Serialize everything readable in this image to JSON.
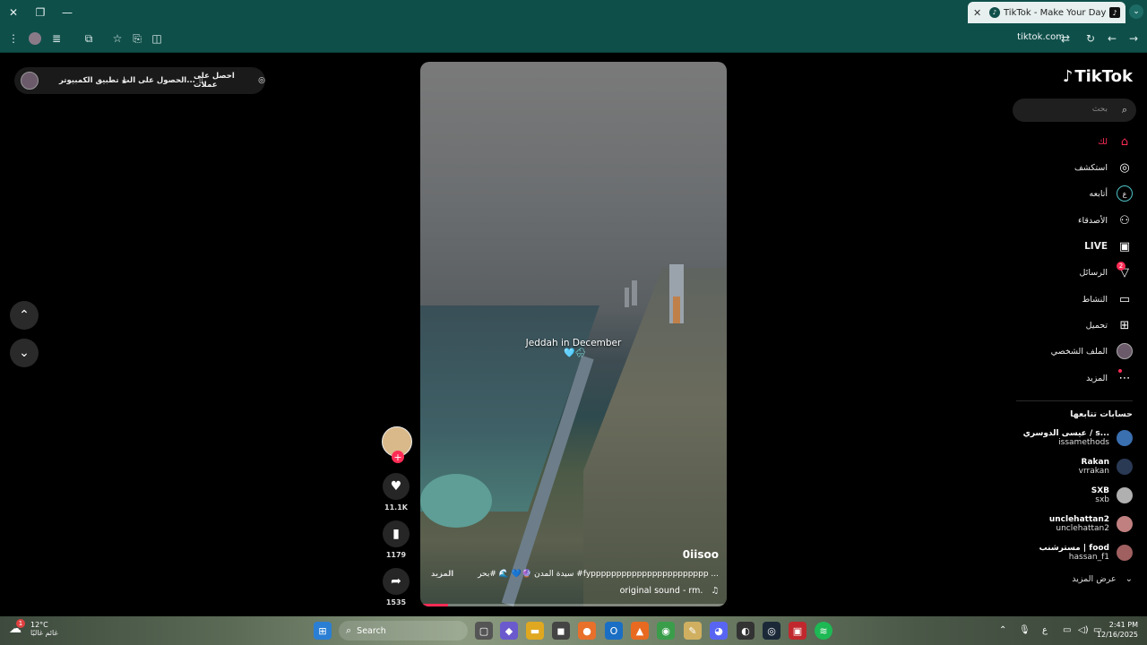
{
  "browser": {
    "tab_title": "TikTok - Make Your Day",
    "url": "tikotok.com",
    "new_tab_label": "+",
    "icons": [
      "close-icon",
      "restore-icon",
      "minimize-icon",
      "menu-icon",
      "profile-icon",
      "media-icon",
      "extensions-icon",
      "star-icon",
      "collections-icon",
      "split-icon",
      "reload-icon",
      "back-icon",
      "forward-icon",
      "tab-dropdown-icon"
    ]
  },
  "url_display": "tiktok.com",
  "promo": {
    "get_coins": "احصل على عملات",
    "get_app": "الحصول على الت...",
    "desktop_app": "تطبيق الكمبيوتر"
  },
  "video": {
    "caption": "Jeddah in December",
    "emoji": "🩵🌧",
    "author": "0iisoo",
    "description": "سيدة المدن 🔮💙 🌊 #بحر #fyppppppppppppppppppppppp ...",
    "more": "المزيد",
    "sound": "original sound - rm.",
    "progress": 0.09
  },
  "actions": {
    "likes": "11.1K",
    "saves": "1179",
    "shares": "1535"
  },
  "sidebar": {
    "logo": "TikTok",
    "search_placeholder": "بحث",
    "items": [
      {
        "label": "لك",
        "icon": "home-icon"
      },
      {
        "label": "استكشف",
        "icon": "compass-icon"
      },
      {
        "label": "أتابعه",
        "icon": "following-icon"
      },
      {
        "label": "الأصدقاء",
        "icon": "friends-icon"
      },
      {
        "label": "LIVE",
        "icon": "live-icon"
      },
      {
        "label": "الرسائل",
        "icon": "messages-icon",
        "badge": "2"
      },
      {
        "label": "النشاط",
        "icon": "activity-icon"
      },
      {
        "label": "تحميل",
        "icon": "upload-icon"
      },
      {
        "label": "الملف الشخصي",
        "icon": "profile-icon"
      },
      {
        "label": "المزيد",
        "icon": "more-icon"
      }
    ],
    "following_title": "حسابات تتابعها",
    "accounts": [
      {
        "display": "عيسى الدوسري / s...",
        "user": "issamethods",
        "color": "#3a6fb0"
      },
      {
        "display": "Rakan",
        "user": "vrrakan",
        "color": "#2a3a55"
      },
      {
        "display": "SXB",
        "user": "sxb",
        "color": "#b0b0b0"
      },
      {
        "display": "unclehattan2",
        "user": "unclehattan2",
        "color": "#c08080"
      },
      {
        "display": "مسترشنب | food",
        "user": "hassan_f1",
        "color": "#a06060"
      }
    ],
    "see_more": "عرض المزيد"
  },
  "taskbar": {
    "temp": "12°C",
    "weather_text": "غائم غالبًا",
    "weather_badge": "1",
    "search": "Search",
    "lang": "ع",
    "time": "2:41 PM",
    "date": "12/16/2025"
  }
}
